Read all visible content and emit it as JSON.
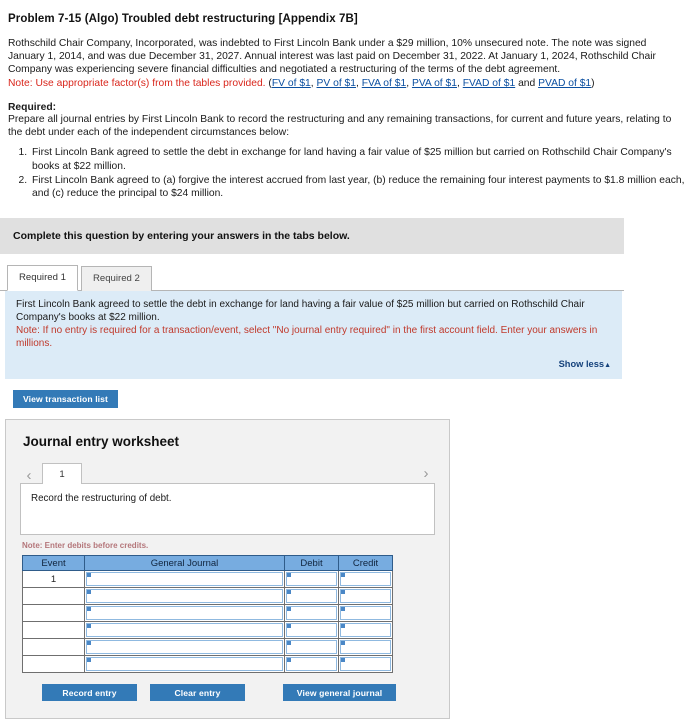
{
  "problem": {
    "title": "Problem 7-15 (Algo) Troubled debt restructuring [Appendix 7B]",
    "stem_p1": "Rothschild Chair Company, Incorporated, was indebted to First Lincoln Bank under a $29 million, 10% unsecured note. The note was signed January 1, 2014, and was due December 31, 2027. Annual interest was last paid on December 31, 2022. At January 1, 2024, Rothschild Chair Company was experiencing severe financial difficulties and negotiated a restructuring of the terms of the debt agreement.",
    "note_label": "Note: Use appropriate factor(s) from the tables provided.",
    "links_open": "(",
    "links": [
      "FV of $1",
      "PV of $1",
      "FVA of $1",
      "PVA of $1",
      "FVAD of $1",
      "PVAD of $1"
    ],
    "links_and": " and ",
    "links_close": ")",
    "required_label": "Required:",
    "required_text": "Prepare all journal entries by First Lincoln Bank to record the restructuring and any remaining transactions, for current and future years, relating to the debt under each of the independent circumstances below:",
    "requirements": [
      "First Lincoln Bank agreed to settle the debt in exchange for land having a fair value of $25 million but carried on Rothschild Chair Company's books at $22 million.",
      "First Lincoln Bank agreed to (a) forgive the interest accrued from last year, (b) reduce the remaining four interest payments to $1.8 million each, and (c) reduce the principal to $24 million."
    ]
  },
  "banner": {
    "text": "Complete this question by entering your answers in the tabs below."
  },
  "tabs": [
    {
      "label": "Required 1",
      "active": true
    },
    {
      "label": "Required 2",
      "active": false
    }
  ],
  "info_box": {
    "line1": "First Lincoln Bank agreed to settle the debt in exchange for land having a fair value of $25 million but carried on Rothschild Chair Company's books at $22 million.",
    "line2": "Note: If no entry is required for a transaction/event, select \"No journal entry required\" in the first account field. Enter your answers in millions.",
    "show_less": "Show less",
    "show_less_caret": "▲"
  },
  "buttons": {
    "view_transaction_list": "View transaction list",
    "record_entry": "Record entry",
    "clear_entry": "Clear entry",
    "view_general_journal": "View general journal"
  },
  "worksheet": {
    "title": "Journal entry worksheet",
    "prev_icon": "‹",
    "next_icon": "›",
    "page_tab": "1",
    "description": "Record the restructuring of debt.",
    "debit_note": "Note: Enter debits before credits.",
    "table": {
      "headers": [
        "Event",
        "General Journal",
        "Debit",
        "Credit"
      ],
      "rows": [
        {
          "event": "1",
          "general_journal": "",
          "debit": "",
          "credit": ""
        },
        {
          "event": "",
          "general_journal": "",
          "debit": "",
          "credit": ""
        },
        {
          "event": "",
          "general_journal": "",
          "debit": "",
          "credit": ""
        },
        {
          "event": "",
          "general_journal": "",
          "debit": "",
          "credit": ""
        },
        {
          "event": "",
          "general_journal": "",
          "debit": "",
          "credit": ""
        },
        {
          "event": "",
          "general_journal": "",
          "debit": "",
          "credit": ""
        }
      ]
    }
  },
  "colors": {
    "accent_blue": "#337ab7",
    "table_header_blue": "#77ace0",
    "info_blue": "#dcebf7",
    "banner_gray": "#e0e0e0",
    "note_red": "#d9261c",
    "link_blue": "#0b4fa0"
  }
}
